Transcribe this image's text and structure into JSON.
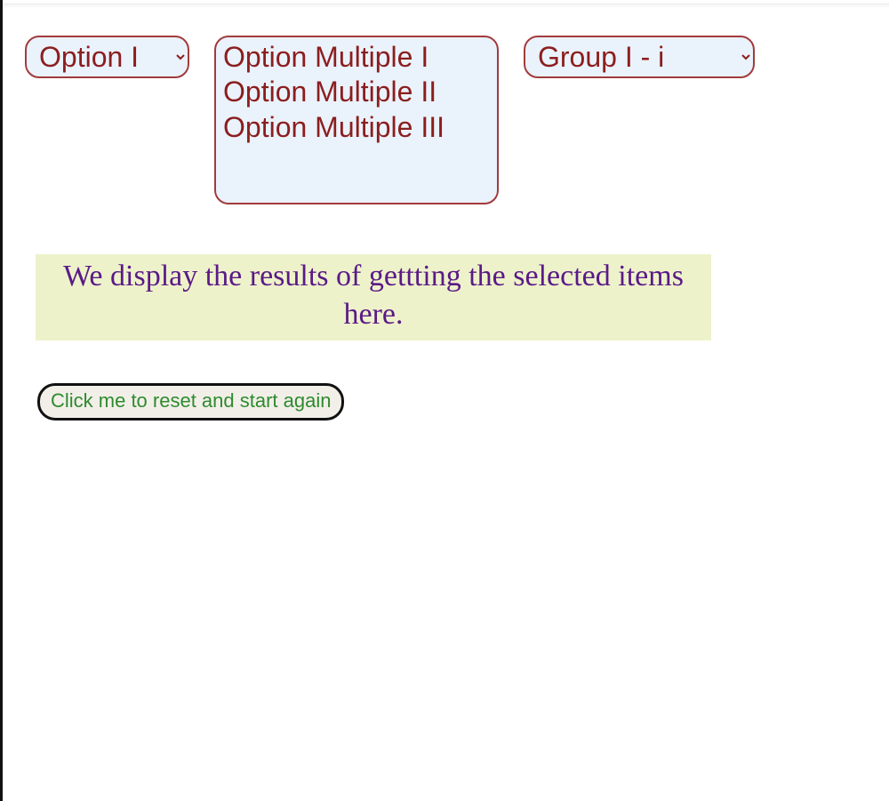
{
  "colors": {
    "select_text": "#8b1e1e",
    "select_border": "#a23b3b",
    "select_bg": "#eaf2fb",
    "result_bg": "#eef2ca",
    "result_text": "#5a1a87",
    "button_text": "#2e8b2e",
    "button_border": "#111111",
    "button_bg": "#f2efe9"
  },
  "selects": {
    "single": {
      "selected": "Option I",
      "options": [
        "Option I"
      ]
    },
    "multiple": {
      "options": [
        "Option Multiple I",
        "Option Multiple II",
        "Option Multiple III"
      ]
    },
    "grouped": {
      "selected": "Group I - i",
      "options": [
        "Group I - i"
      ]
    }
  },
  "result": {
    "text": "We display the results of gettting the selected items here."
  },
  "reset_button": {
    "label": "Click me to reset and start again"
  }
}
